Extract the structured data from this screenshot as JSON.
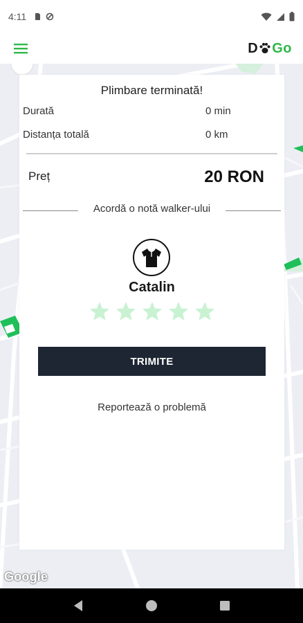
{
  "status_bar": {
    "time": "4:11"
  },
  "app_bar": {
    "logo_prefix": "D",
    "logo_suffix": "Go",
    "brand_color": "#2fb84a",
    "menu_icon": "hamburger-menu-icon"
  },
  "summary": {
    "title": "Plimbare terminată!",
    "duration_label": "Durată",
    "duration_value": "0 min",
    "distance_label": "Distanța totală",
    "distance_value": "0 km",
    "price_label": "Preț",
    "price_value": "20 RON"
  },
  "rating": {
    "prompt": "Acordă o notă walker-ului",
    "walker_name": "Catalin",
    "max_stars": 5,
    "selected_stars": 0,
    "star_color": "#c9f2d2",
    "avatar_icon": "tshirt-icon"
  },
  "actions": {
    "submit_label": "TRIMITE",
    "submit_color": "#1e2633",
    "report_label": "Reportează o problemă"
  },
  "map": {
    "attribution": "Google"
  },
  "nav_bar": {
    "back_icon": "back-triangle-icon",
    "home_icon": "home-circle-icon",
    "recents_icon": "recents-square-icon"
  }
}
